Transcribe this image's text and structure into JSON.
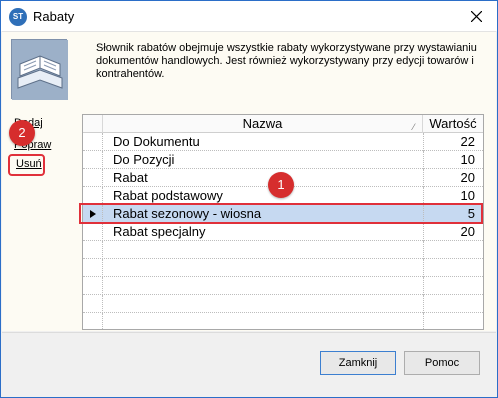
{
  "window": {
    "title": "Rabaty",
    "app_icon_text": "ST"
  },
  "description": "Słownik rabatów obejmuje wszystkie rabaty wykorzystywane przy wystawianiu dokumentów handlowych. Jest również wykorzystywany przy edycji towarów i kontrahentów.",
  "actions": {
    "add": "Dodaj",
    "edit": "Popraw",
    "delete": "Usuń"
  },
  "annotations": {
    "badge_1": "1",
    "badge_2": "2"
  },
  "table": {
    "columns": [
      "Nazwa",
      "Wartość"
    ],
    "rows": [
      {
        "name": "Do Dokumentu",
        "value": "22"
      },
      {
        "name": "Do Pozycji",
        "value": "10"
      },
      {
        "name": "Rabat",
        "value": "20"
      },
      {
        "name": "Rabat podstawowy",
        "value": "10"
      },
      {
        "name": "Rabat sezonowy - wiosna",
        "value": "5"
      },
      {
        "name": "Rabat specjalny",
        "value": "20"
      }
    ],
    "selected_row": 4
  },
  "buttons": {
    "close": "Zamknij",
    "help": "Pomoc"
  },
  "colors": {
    "accent": "#2b6ec8",
    "annotation": "#e0303a",
    "selection": "#c6d9f1"
  }
}
